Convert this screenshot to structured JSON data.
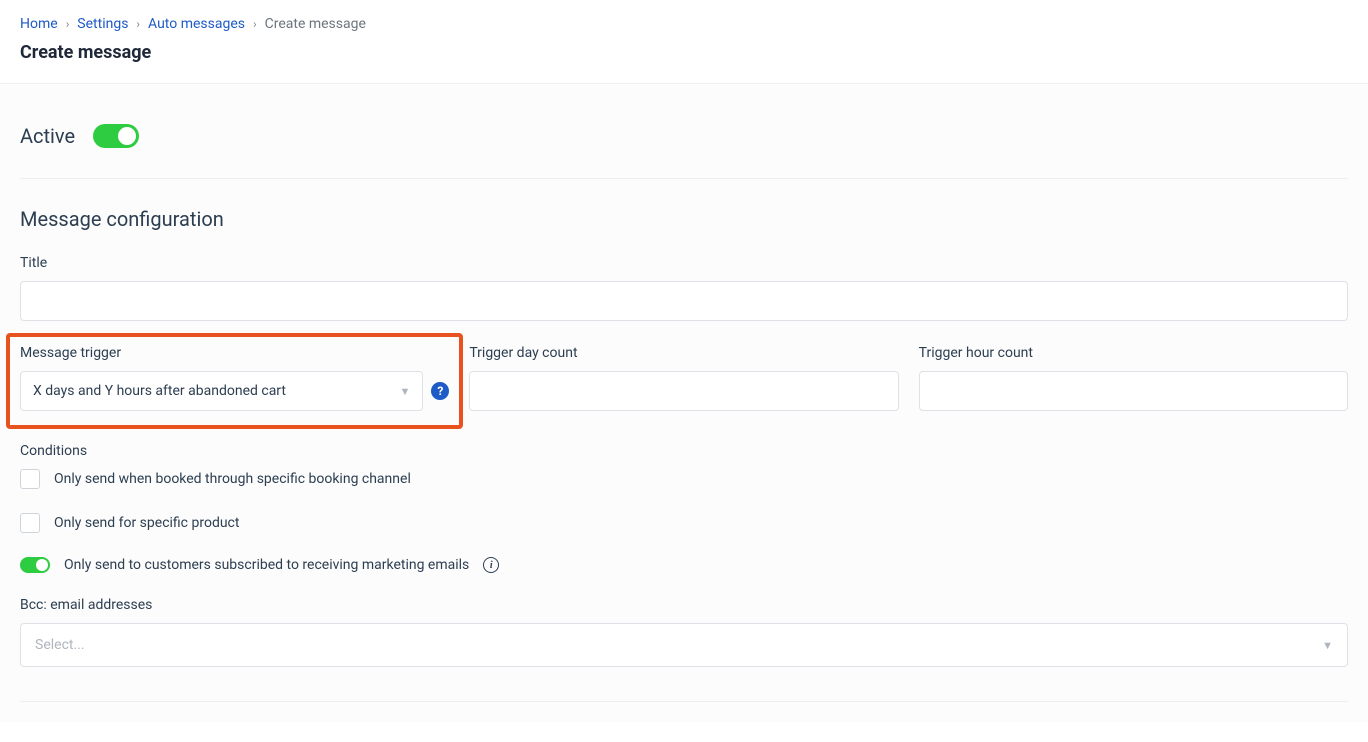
{
  "breadcrumb": {
    "home": "Home",
    "settings": "Settings",
    "auto_messages": "Auto messages",
    "current": "Create message"
  },
  "page_title": "Create message",
  "active": {
    "label": "Active",
    "on": true
  },
  "config": {
    "heading": "Message configuration",
    "title_label": "Title",
    "title_value": "",
    "trigger_label": "Message trigger",
    "trigger_value": "X days and Y hours after abandoned cart",
    "day_count_label": "Trigger day count",
    "day_count_value": "",
    "hour_count_label": "Trigger hour count",
    "hour_count_value": ""
  },
  "conditions": {
    "heading": "Conditions",
    "channel_label": "Only send when booked through specific booking channel",
    "product_label": "Only send for specific product",
    "subscribed_label": "Only send to customers subscribed to receiving marketing emails",
    "subscribed_on": true
  },
  "bcc": {
    "label": "Bcc: email addresses",
    "placeholder": "Select..."
  }
}
